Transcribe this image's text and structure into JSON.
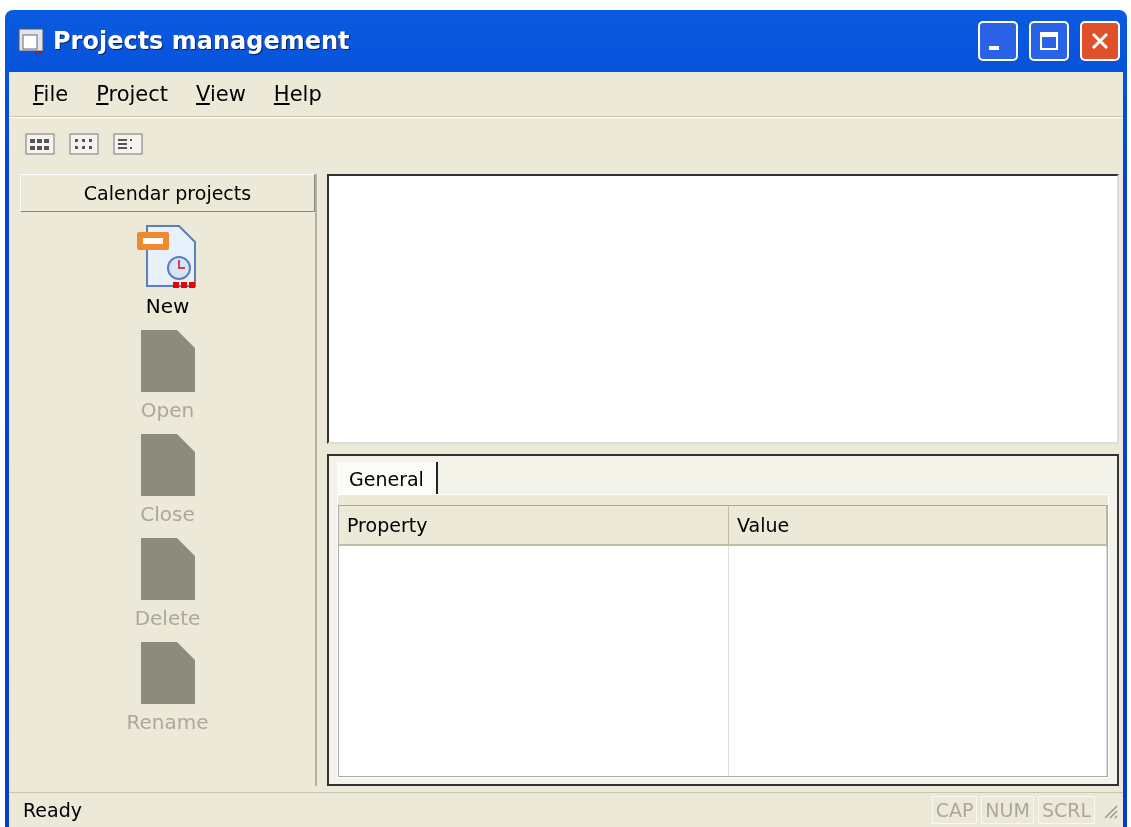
{
  "window": {
    "title": "Projects management"
  },
  "menu": [
    {
      "label": "File"
    },
    {
      "label": "Project"
    },
    {
      "label": "View"
    },
    {
      "label": "Help"
    }
  ],
  "toolbar": [
    {
      "kind": "large"
    },
    {
      "kind": "small"
    },
    {
      "kind": "list"
    }
  ],
  "sidebar": {
    "title": "Calendar projects",
    "items": [
      {
        "label": "New",
        "disabled": false
      },
      {
        "label": "Open",
        "disabled": true
      },
      {
        "label": "Close",
        "disabled": true
      },
      {
        "label": "Delete",
        "disabled": true
      },
      {
        "label": "Rename",
        "disabled": true
      }
    ]
  },
  "properties": {
    "tabs": [
      {
        "label": "General",
        "selected": true
      }
    ],
    "columns": [
      "Property",
      "Value"
    ]
  },
  "status_bar": {
    "text": "Ready",
    "indicators": [
      {
        "label": "CAP",
        "disabled": true
      },
      {
        "label": "NUM",
        "disabled": true
      },
      {
        "label": "SCRL",
        "disabled": true
      }
    ]
  }
}
